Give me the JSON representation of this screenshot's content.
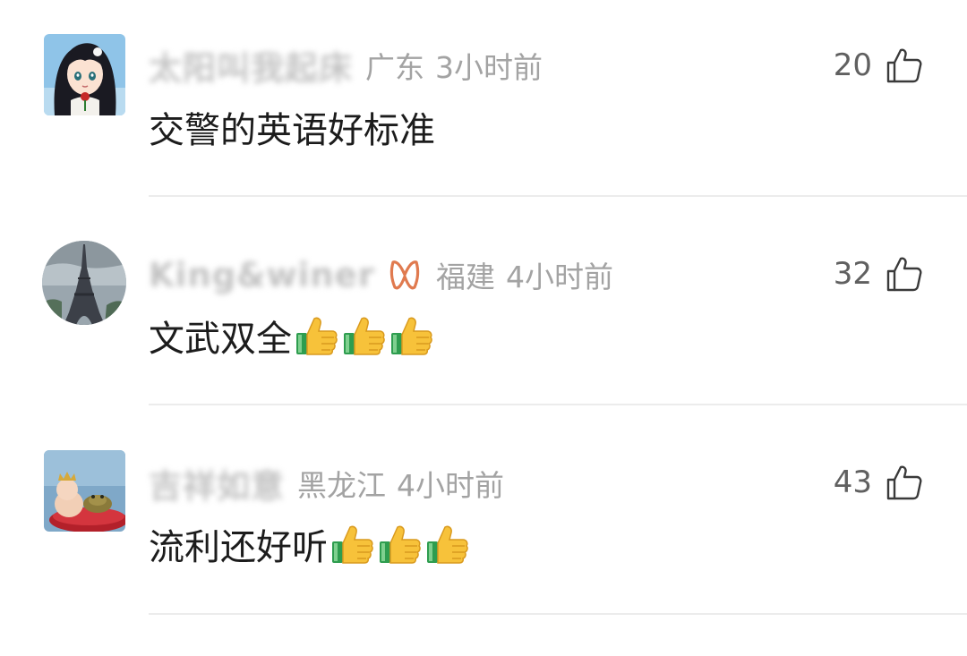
{
  "comments": [
    {
      "username": "太阳叫我起床",
      "location": "广东",
      "time": "3小时前",
      "likes": "20",
      "content": "交警的英语好标准",
      "emoji_count": 0,
      "avatar": "anime-girl-avatar",
      "vip": false
    },
    {
      "username": "King&winer",
      "location": "福建",
      "time": "4小时前",
      "likes": "32",
      "content": "文武双全",
      "emoji_count": 3,
      "avatar": "eiffel-tower-avatar",
      "vip": true
    },
    {
      "username": "吉祥如意",
      "location": "黑龙江",
      "time": "4小时前",
      "likes": "43",
      "content": "流利还好听",
      "emoji_count": 3,
      "avatar": "baby-frog-avatar",
      "vip": false
    }
  ],
  "icons": {
    "like": "thumbs-up-outline-icon",
    "emoji": "thumbs-up-emoji",
    "vip": "vip-badge-icon"
  },
  "colors": {
    "meta_text": "#a3a3a3",
    "like_count": "#606060",
    "content_text": "#1c1c1c",
    "divider": "#ececec",
    "vip_badge": "#e07a4f"
  }
}
